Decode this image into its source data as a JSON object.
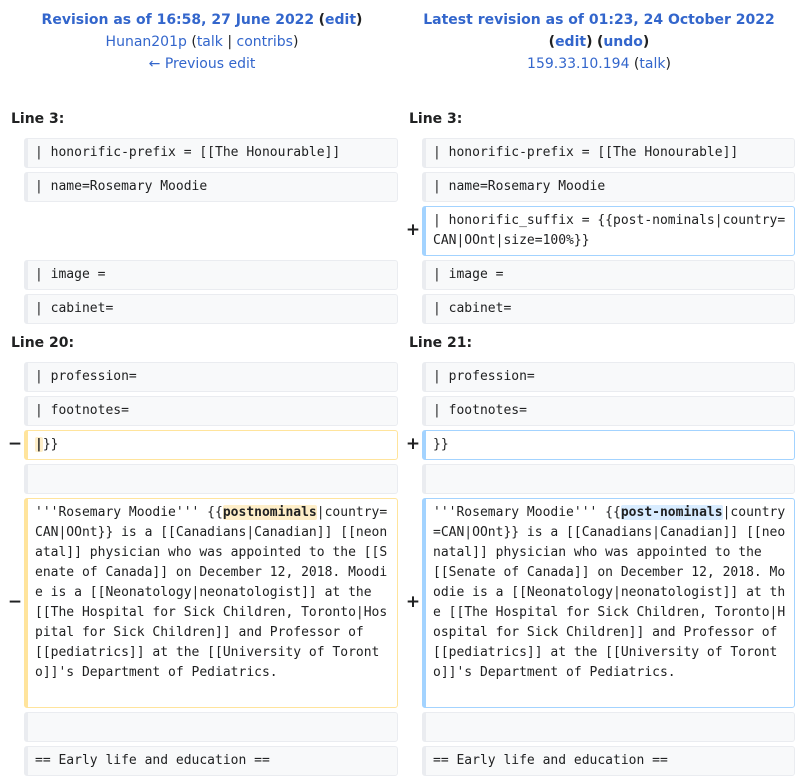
{
  "left_header": {
    "title_prefix": "Revision as of 16:58, 27 June 2022",
    "edit": "edit",
    "user": "Hunan201p",
    "talk": "talk",
    "contribs": "contribs",
    "prev_edit": "← Previous edit"
  },
  "right_header": {
    "title_prefix": "Latest revision as of 01:23, 24 October 2022",
    "edit": "edit",
    "undo": "undo",
    "user": "159.33.10.194",
    "talk": "talk"
  },
  "block1": {
    "left_line": "Line 3:",
    "right_line": "Line 3:"
  },
  "block2": {
    "left_line": "Line 20:",
    "right_line": "Line 21:"
  },
  "markers": {
    "minus": "−",
    "plus": "+"
  },
  "rows": {
    "r1": "| honorific-prefix = [[The Honourable]]",
    "r2": "| name=Rosemary Moodie",
    "r3_added": "| honorific_suffix = {{post-nominals|country=CAN|OOnt|size=100%}}",
    "r4": "| image =",
    "r5": "| cabinet=",
    "r6": "| profession=",
    "r7": "| footnotes=",
    "r8_left_hl": "|",
    "r8_left_rest": "}}",
    "r8_right": "}}",
    "r10_left_a": "'''Rosemary Moodie''' {{",
    "r10_left_hl": "postnominals",
    "r10_left_b": "|country=CAN|OOnt}} is a [[Canadians|Canadian]] [[neonatal]] physician who was appointed to the [[Senate of Canada]] on December 12, 2018. Moodie is a [[Neonatology|neonatologist]] at the [[The Hospital for Sick Children, Toronto|Hospital for Sick Children]] and Professor of [[pediatrics]] at the [[University of Toronto]]'s Department of Pediatrics.",
    "r10_right_a": "'''Rosemary Moodie''' {{",
    "r10_right_hl": "post-nominals",
    "r10_right_b": "|country=CAN|OOnt}} is a [[Canadians|Canadian]] [[neonatal]] physician who was appointed to the [[Senate of Canada]] on December 12, 2018. Moodie is a [[Neonatology|neonatologist]] at the [[The Hospital for Sick Children, Toronto|Hospital for Sick Children]] and Professor of [[pediatrics]] at the [[University of Toronto]]'s Department of Pediatrics.",
    "r12": "== Early life and education =="
  }
}
